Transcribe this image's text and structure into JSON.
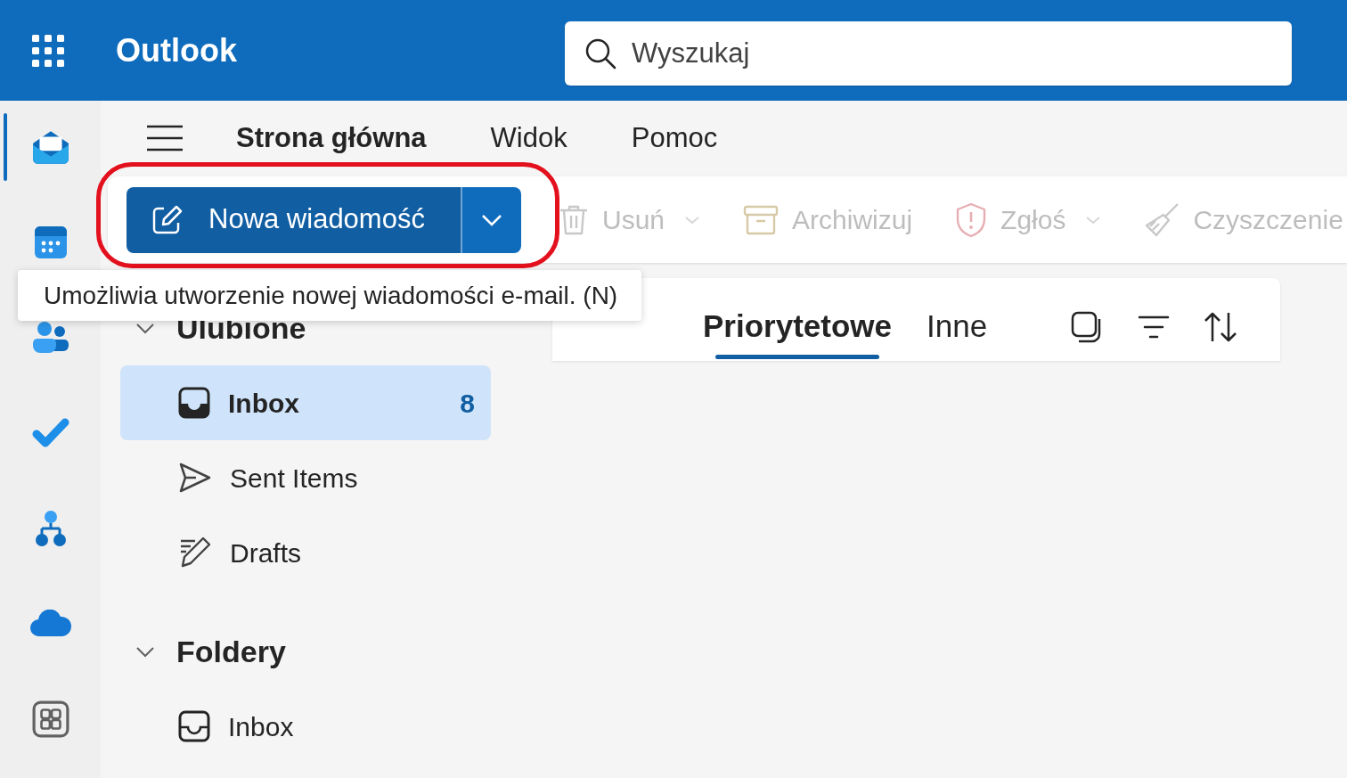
{
  "header": {
    "app_title": "Outlook",
    "search": {
      "placeholder": "Wyszukaj"
    }
  },
  "app_rail": [
    {
      "kind": "mail",
      "selected": true
    },
    {
      "kind": "calendar",
      "selected": false
    },
    {
      "kind": "people",
      "selected": false
    },
    {
      "kind": "todo",
      "selected": false
    },
    {
      "kind": "org",
      "selected": false
    },
    {
      "kind": "cloud",
      "selected": false
    },
    {
      "kind": "apps",
      "selected": false
    }
  ],
  "ribbon_tabs": [
    {
      "label": "Strona główna",
      "selected": true
    },
    {
      "label": "Widok",
      "selected": false
    },
    {
      "label": "Pomoc",
      "selected": false
    }
  ],
  "toolbar": {
    "new_message": {
      "label": "Nowa wiadomość",
      "highlighted": true
    },
    "actions": [
      {
        "kind": "delete",
        "label": "Usuń",
        "disabled": true,
        "menu": true
      },
      {
        "kind": "archive",
        "label": "Archiwizuj",
        "disabled": true,
        "menu": false
      },
      {
        "kind": "report",
        "label": "Zgłoś",
        "disabled": true,
        "menu": true
      },
      {
        "kind": "sweep",
        "label": "Czyszczenie",
        "disabled": true,
        "menu": false
      }
    ]
  },
  "tooltip": {
    "text": "Umożliwia utworzenie nowej wiadomości e-mail. (N)"
  },
  "folder_pane": {
    "sections": [
      {
        "title": "Ulubione",
        "expanded": true,
        "folders": [
          {
            "kind": "inbox",
            "label": "Inbox",
            "count": "8",
            "selected": true
          },
          {
            "kind": "sent",
            "label": "Sent Items",
            "selected": false
          },
          {
            "kind": "drafts",
            "label": "Drafts",
            "selected": false
          }
        ]
      },
      {
        "title": "Foldery",
        "expanded": true,
        "folders": [
          {
            "kind": "inbox",
            "label": "Inbox",
            "selected": false
          }
        ]
      }
    ]
  },
  "message_list": {
    "tabs": [
      {
        "label": "Priorytetowe",
        "selected": true
      },
      {
        "label": "Inne",
        "selected": false
      }
    ]
  }
}
